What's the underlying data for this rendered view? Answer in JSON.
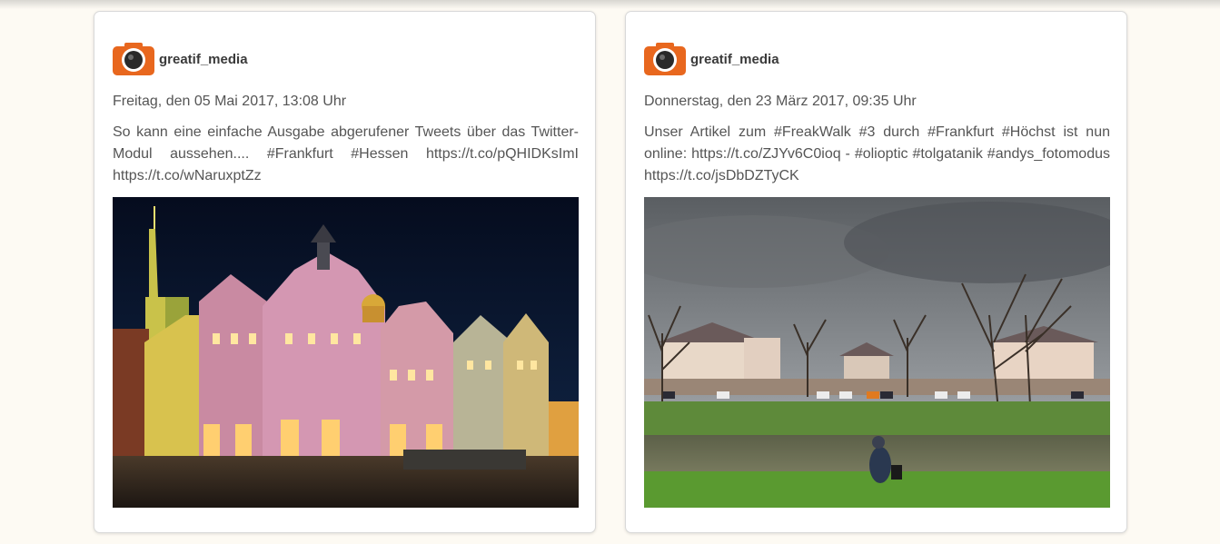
{
  "posts": [
    {
      "author": "greatif_media",
      "avatar_icon": "camera-icon",
      "date": "Freitag, den 05 Mai 2017, 13:08 Uhr",
      "text": "So kann eine einfache Ausgabe abgerufener Tweets über das Twitter-Modul aussehen.... #Frankfurt #Hessen https://t.co/pQHIDKsImI https://t.co/wNaruxptZz"
    },
    {
      "author": "greatif_media",
      "avatar_icon": "camera-icon",
      "date": "Donnerstag, den 23 März 2017, 09:35 Uhr",
      "text": "Unser Artikel zum #FreakWalk #3 durch #Frankfurt #Höchst ist nun online: https://t.co/ZJYv6C0ioq - #olioptic #tolgatanik #andys_fotomodus https://t.co/jsDbDZTyCK"
    }
  ],
  "colors": {
    "avatar_orange": "#e8671e",
    "page_bg": "#fdfaf3"
  }
}
